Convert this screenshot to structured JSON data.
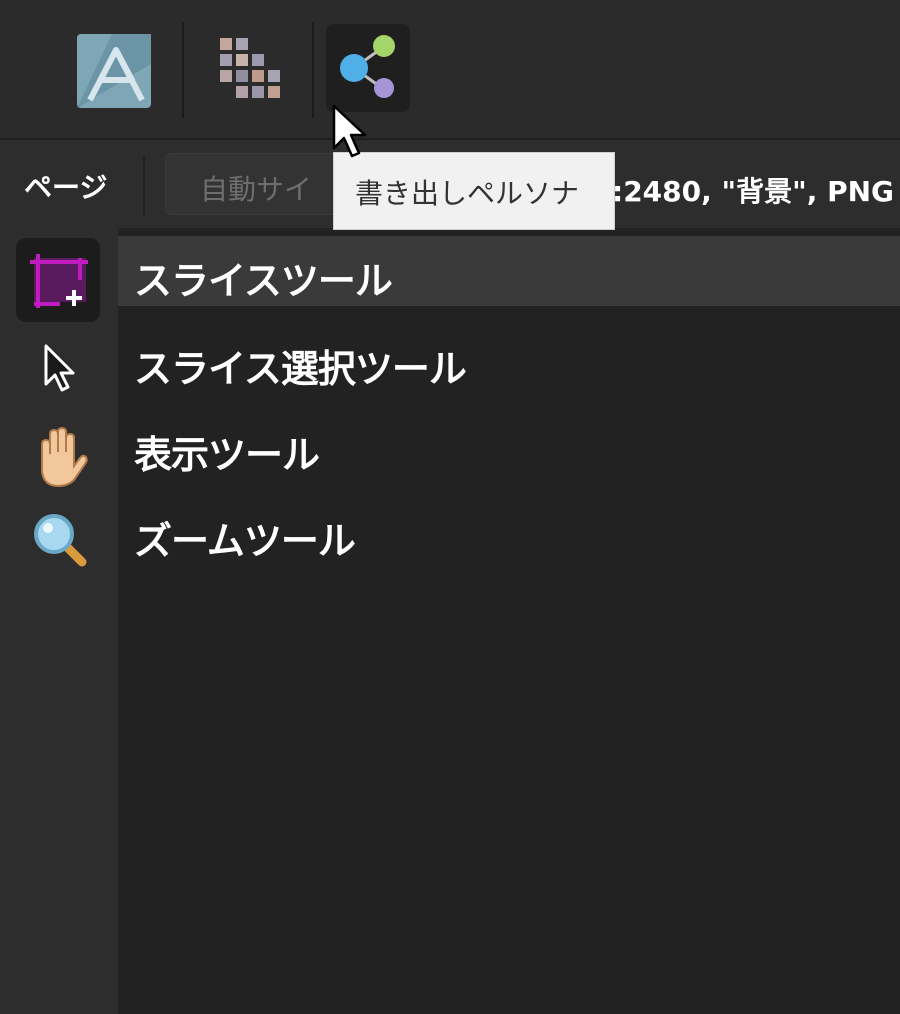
{
  "personas": [
    {
      "name": "Affinity Designer",
      "icon": "affinity-designer-icon",
      "color": "#7fa6b5"
    },
    {
      "name": "Pixel Persona",
      "icon": "pixel-persona-icon",
      "colors": [
        "#b9a5a5",
        "#8f8fa0",
        "#c09a8a"
      ]
    },
    {
      "name": "書き出しペルソナ",
      "icon": "export-persona-icon",
      "colors": [
        "#4fb0e8",
        "#a3d56a",
        "#a596d8"
      ]
    }
  ],
  "context": {
    "page_label": "ページ",
    "auto_size_label": "自動サイ",
    "info": ":2480, \"背景\", PNG"
  },
  "tooltip": {
    "text": "書き出しペルソナ"
  },
  "tools": [
    {
      "name": "スライスツール",
      "icon": "slice-tool-icon",
      "selected": true,
      "accent": "#c01ac0"
    },
    {
      "name": "スライス選択ツール",
      "icon": "pointer-arrow-icon"
    },
    {
      "name": "表示ツール",
      "icon": "hand-icon"
    },
    {
      "name": "ズームツール",
      "icon": "zoom-magnifier-icon"
    }
  ]
}
